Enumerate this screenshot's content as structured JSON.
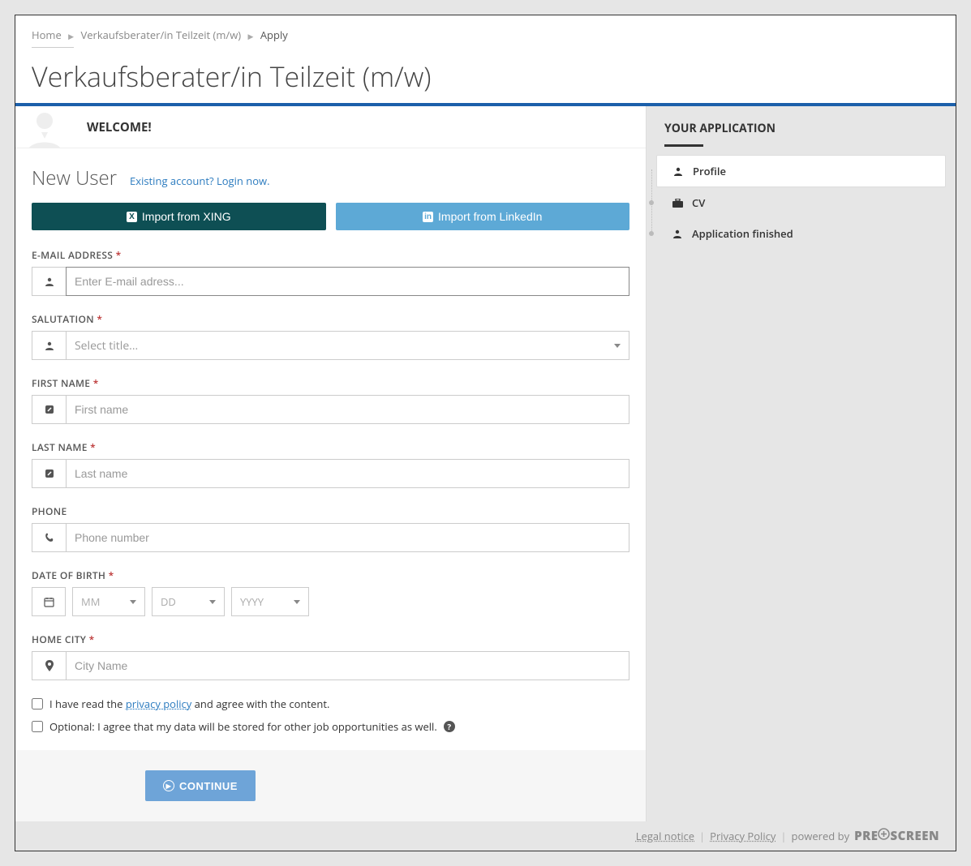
{
  "breadcrumb": {
    "home": "Home",
    "job": "Verkaufsberater/in Teilzeit (m/w)",
    "current": "Apply"
  },
  "page_title": "Verkaufsberater/in Teilzeit (m/w)",
  "welcome_title": "WELCOME!",
  "new_user": {
    "title": "New User",
    "login_link": "Existing account? Login now."
  },
  "buttons": {
    "xing": "Import from XING",
    "linkedin": "Import from LinkedIn",
    "continue": "CONTINUE"
  },
  "fields": {
    "email": {
      "label": "E-MAIL ADDRESS",
      "required": true,
      "placeholder": "Enter E-mail adress..."
    },
    "salutation": {
      "label": "SALUTATION",
      "required": true,
      "placeholder": "Select title..."
    },
    "firstname": {
      "label": "FIRST NAME",
      "required": true,
      "placeholder": "First name"
    },
    "lastname": {
      "label": "LAST NAME",
      "required": true,
      "placeholder": "Last name"
    },
    "phone": {
      "label": "PHONE",
      "required": false,
      "placeholder": "Phone number"
    },
    "dob": {
      "label": "DATE OF BIRTH",
      "required": true,
      "mm": "MM",
      "dd": "DD",
      "yyyy": "YYYY"
    },
    "homecity": {
      "label": "HOME CITY",
      "required": true,
      "placeholder": "City Name"
    }
  },
  "checkboxes": {
    "privacy_pre": "I have read the ",
    "privacy_link": "privacy policy",
    "privacy_post": " and agree with the content.",
    "optional": "Optional: I agree that my data will be stored for other job opportunities as well."
  },
  "sidebar": {
    "title": "YOUR APPLICATION",
    "steps": [
      {
        "label": "Profile",
        "icon": "user"
      },
      {
        "label": "CV",
        "icon": "briefcase"
      },
      {
        "label": "Application finished",
        "icon": "user"
      }
    ]
  },
  "footer": {
    "legal": "Legal notice",
    "privacy": "Privacy Policy",
    "powered": "powered by",
    "brand_pre": "PRE",
    "brand_post": "SCREEN"
  }
}
